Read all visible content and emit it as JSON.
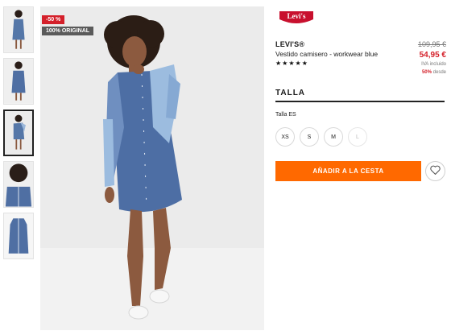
{
  "gallery": {
    "badges": {
      "discount": "-50 %",
      "original": "100% ORIGINAL"
    }
  },
  "product": {
    "logo_text": "Levi's",
    "brand": "LEVI'S®",
    "name": "Vestido camisero - workwear blue",
    "stars": "★★★★★",
    "rating": 5,
    "price_old": "109,95 €",
    "price_new": "54,95 €",
    "vat_note": "IVA incluido",
    "saving_pct": "50%",
    "saving_word": "desde"
  },
  "size": {
    "heading": "TALLA",
    "label": "Talla ES",
    "options": [
      "XS",
      "S",
      "M",
      "L"
    ]
  },
  "actions": {
    "add_to_cart": "AÑADIR A LA CESTA"
  },
  "colors": {
    "accent": "#ff6900",
    "sale": "#d4202a",
    "denim": "#4f6fa3"
  }
}
